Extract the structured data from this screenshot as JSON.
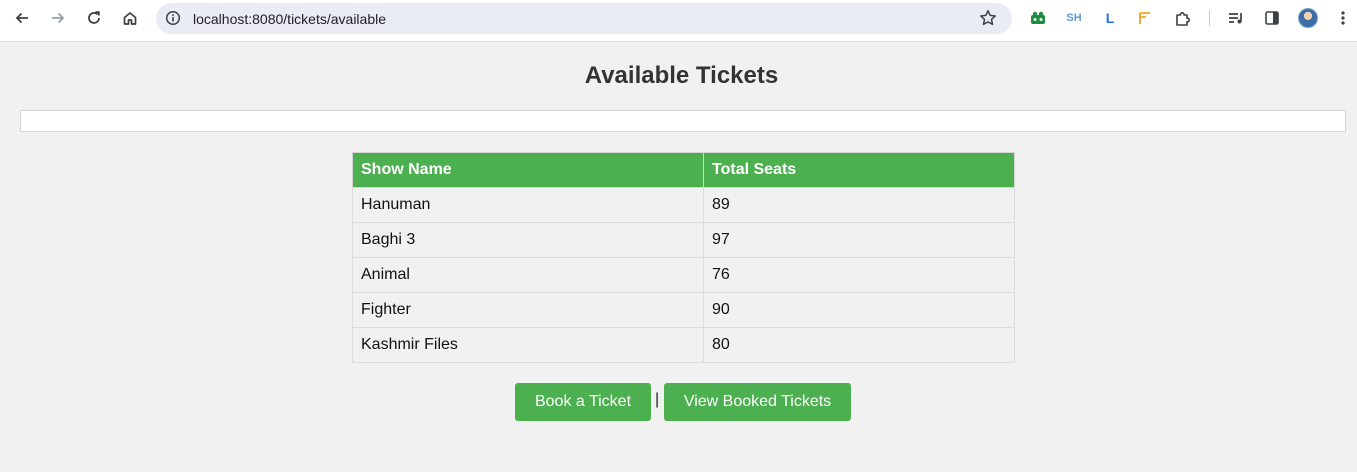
{
  "browser": {
    "url": "localhost:8080/tickets/available",
    "extensions": {
      "sh_label": "SH",
      "l_label": "L"
    }
  },
  "page": {
    "title": "Available Tickets",
    "table": {
      "headers": [
        "Show Name",
        "Total Seats"
      ],
      "rows": [
        [
          "Hanuman",
          "89"
        ],
        [
          "Baghi 3",
          "97"
        ],
        [
          "Animal",
          "76"
        ],
        [
          "Fighter",
          "90"
        ],
        [
          "Kashmir Files",
          "80"
        ]
      ]
    },
    "buttons": {
      "book": "Book a Ticket",
      "separator": "|",
      "view": "View Booked Tickets"
    }
  },
  "colors": {
    "accent": "#4caf50",
    "background": "#f1f1f1"
  },
  "icons": [
    "back-icon",
    "forward-icon",
    "reload-icon",
    "home-icon",
    "info-icon",
    "star-icon",
    "extension-icon",
    "reading-list-icon",
    "side-panel-icon",
    "menu-icon"
  ]
}
